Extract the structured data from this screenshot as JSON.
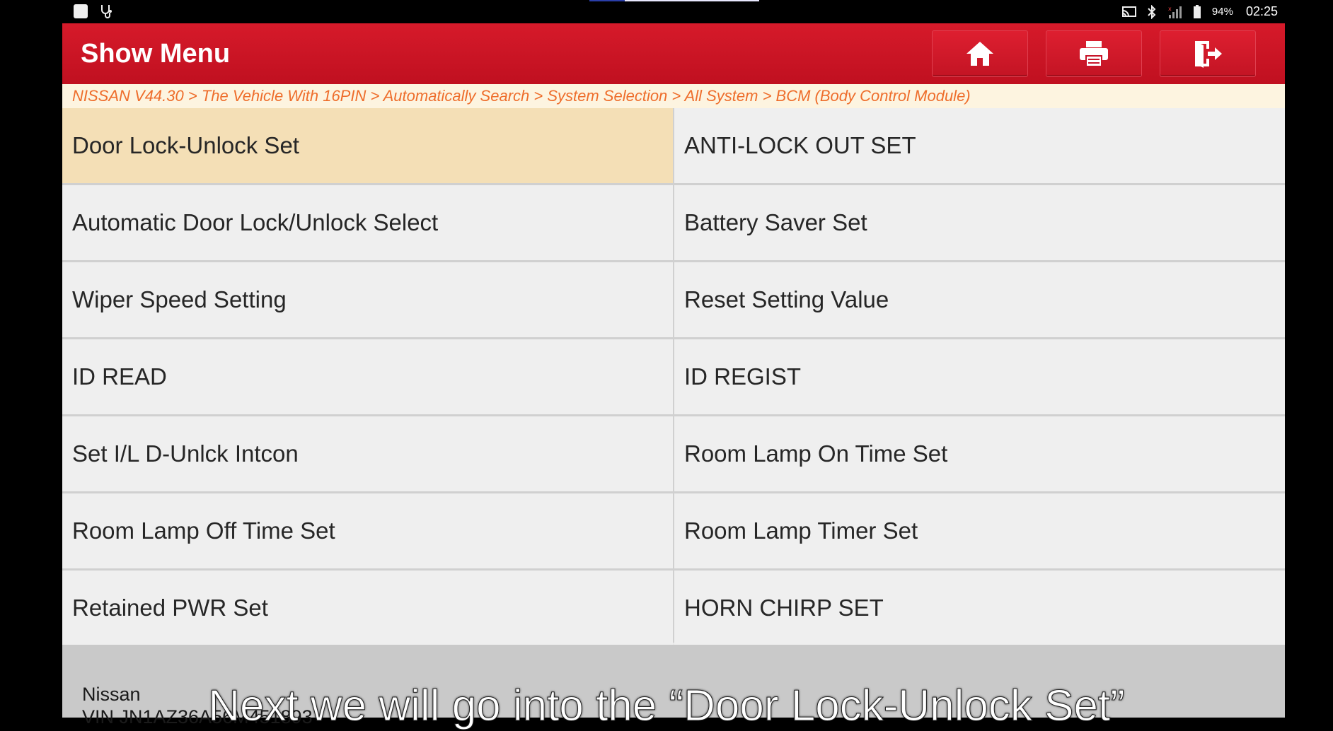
{
  "status_bar": {
    "battery_percent": "94%",
    "time": "02:25",
    "icons": [
      "app-square-icon",
      "diagnostic-icon",
      "cast-icon",
      "bluetooth-icon",
      "signal-icon",
      "battery-icon"
    ]
  },
  "header": {
    "title": "Show Menu",
    "buttons": [
      "home-icon",
      "print-icon",
      "exit-icon"
    ],
    "color": "#c8152a"
  },
  "breadcrumb": "NISSAN V44.30 > The Vehicle With 16PIN > Automatically Search > System Selection > All System > BCM (Body Control Module)",
  "menu": {
    "items": [
      {
        "label": "Door Lock-Unlock Set",
        "selected": true
      },
      {
        "label": "ANTI-LOCK OUT SET",
        "selected": false
      },
      {
        "label": "Automatic Door Lock/Unlock Select",
        "selected": false
      },
      {
        "label": "Battery Saver Set",
        "selected": false
      },
      {
        "label": "Wiper Speed Setting",
        "selected": false
      },
      {
        "label": "Reset Setting Value",
        "selected": false
      },
      {
        "label": "ID READ",
        "selected": false
      },
      {
        "label": "ID REGIST",
        "selected": false
      },
      {
        "label": "Set I/L D-Unlck Intcon",
        "selected": false
      },
      {
        "label": "Room Lamp On Time Set",
        "selected": false
      },
      {
        "label": "Room Lamp Off Time Set",
        "selected": false
      },
      {
        "label": "Room Lamp Timer Set",
        "selected": false
      },
      {
        "label": "Retained PWR Set",
        "selected": false
      },
      {
        "label": "HORN CHIRP SET",
        "selected": false
      }
    ],
    "selected_color": "#f4dfb6"
  },
  "footer": {
    "make": "Nissan",
    "vin": "VIN JN1AZ36A56M451893"
  },
  "subtitle": "Next we will go into the “Door Lock-Unlock Set”"
}
